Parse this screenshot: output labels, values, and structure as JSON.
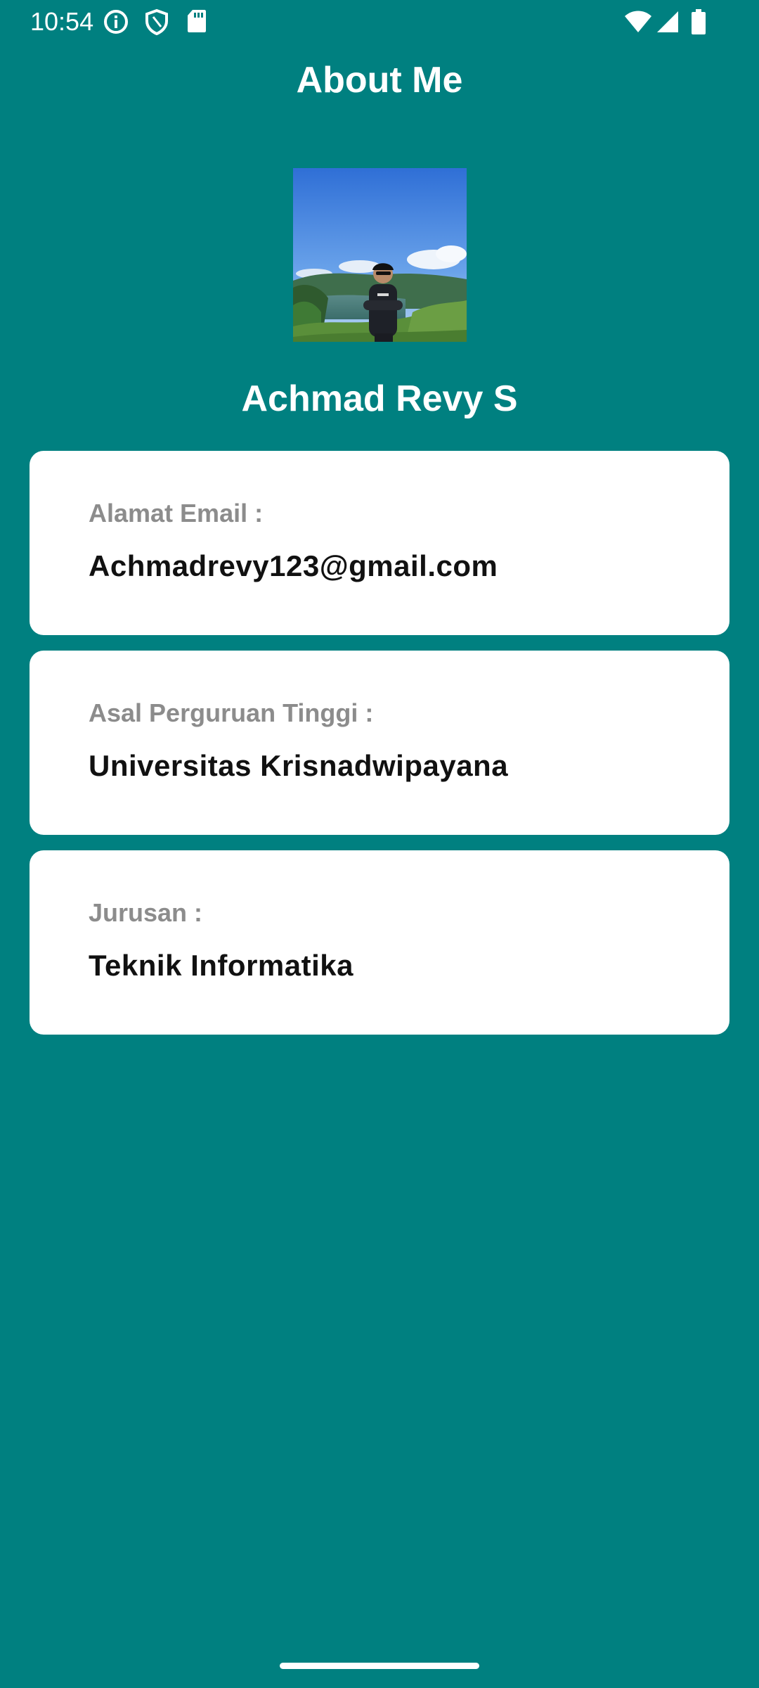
{
  "status_bar": {
    "time": "10:54",
    "icons": [
      "info-icon",
      "shield-icon",
      "sd-card-icon",
      "wifi-icon",
      "signal-icon",
      "battery-icon"
    ]
  },
  "app": {
    "title": "About Me"
  },
  "profile": {
    "name": "Achmad Revy S",
    "photo_desc": "profile-photo"
  },
  "cards": [
    {
      "label": "Alamat Email :",
      "value": "Achmadrevy123@gmail.com"
    },
    {
      "label": "Asal Perguruan Tinggi :",
      "value": "Universitas Krisnadwipayana"
    },
    {
      "label": "Jurusan :",
      "value": "Teknik Informatika"
    }
  ],
  "colors": {
    "background": "#008080",
    "card": "#ffffff",
    "label": "#8c8c8c",
    "value": "#111111"
  }
}
